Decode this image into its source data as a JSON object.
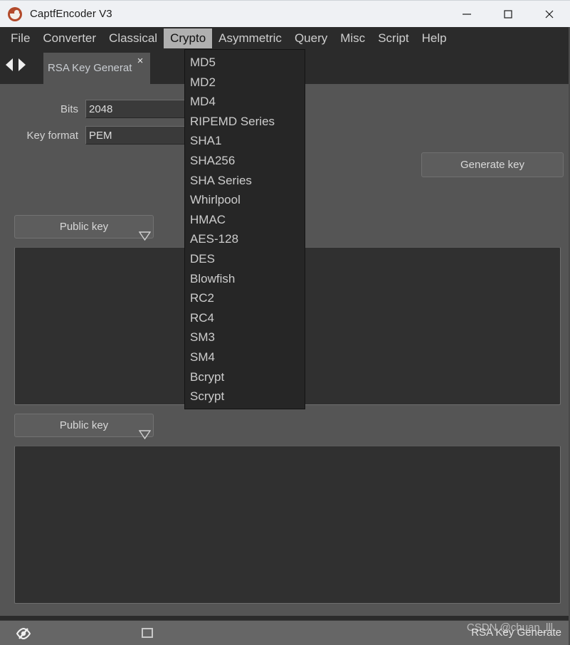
{
  "window": {
    "title": "CaptfEncoder V3",
    "icon": "app-logo-icon",
    "minimize": "minimize-icon",
    "maximize": "maximize-icon",
    "close": "close-icon"
  },
  "menubar": {
    "items": [
      {
        "label": "File",
        "active": false
      },
      {
        "label": "Converter",
        "active": false
      },
      {
        "label": "Classical",
        "active": false
      },
      {
        "label": "Crypto",
        "active": true
      },
      {
        "label": "Asymmetric",
        "active": false
      },
      {
        "label": "Query",
        "active": false
      },
      {
        "label": "Misc",
        "active": false
      },
      {
        "label": "Script",
        "active": false
      },
      {
        "label": "Help",
        "active": false
      }
    ]
  },
  "tabstrip": {
    "prev_icon": "arrow-left-icon",
    "next_icon": "arrow-right-icon",
    "tab": {
      "label": "RSA Key Generat",
      "close": "×"
    }
  },
  "form": {
    "bits": {
      "label": "Bits",
      "value": "2048"
    },
    "key_format": {
      "label": "Key format",
      "value": "PEM"
    },
    "generate_button": "Generate key"
  },
  "panels": [
    {
      "combo_label": "Public key",
      "combo_arrow": "chevron-down-icon",
      "textarea_value": ""
    },
    {
      "combo_label": "Public key",
      "combo_arrow": "chevron-down-icon",
      "textarea_value": ""
    }
  ],
  "dropdown": {
    "owner": "Crypto",
    "items": [
      "MD5",
      "MD2",
      "MD4",
      "RIPEMD Series",
      "SHA1",
      "SHA256",
      "SHA Series",
      "Whirlpool",
      "HMAC",
      "AES-128",
      "DES",
      "Blowfish",
      "RC2",
      "RC4",
      "SM3",
      "SM4",
      "Bcrypt",
      "Scrypt"
    ]
  },
  "statusbar": {
    "eye_icon": "eye-off-icon",
    "square_icon": "square-icon",
    "status_text": "RSA Key Generate",
    "watermark": "CSDN @chuan_lll"
  },
  "colors": {
    "window_bg": "#555555",
    "menubar_bg": "#2b2b2b",
    "titlebar_bg": "#eff1f4",
    "menu_active_bg": "#b0b0b0",
    "textarea_bg": "#303030",
    "dropdown_bg": "#262626",
    "statusbar_bg": "#666666",
    "accent_logo": "#b24a2b"
  }
}
